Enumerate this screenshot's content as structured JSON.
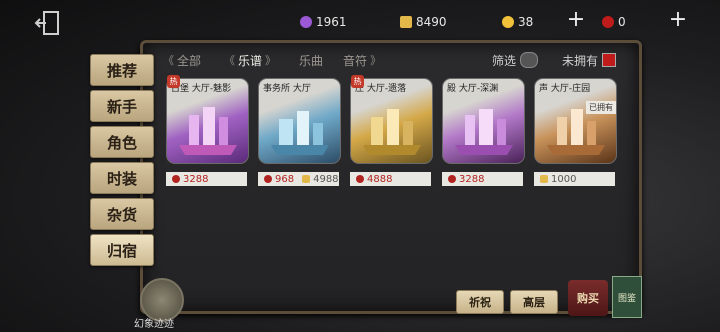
{
  "top_bar": {
    "purple_currency": "1961",
    "puzzle_currency": "8490",
    "gold_currency": "38",
    "red_currency": "0",
    "plus_symbol": "+"
  },
  "side_tabs": [
    "推荐",
    "新手",
    "角色",
    "时装",
    "杂货",
    "归宿"
  ],
  "active_side_tab": "归宿",
  "filter_tabs": [
    {
      "label": "全部",
      "selected": false
    },
    {
      "label": "乐谱",
      "selected": true
    },
    {
      "label": "乐曲",
      "selected": false
    },
    {
      "label": "音符",
      "selected": false
    }
  ],
  "screen_label": "筛选",
  "not_owned_label": "未拥有",
  "cards": [
    {
      "title": "古堡 大厅-魅影",
      "hot": true,
      "price": "3288",
      "hot_label": "热",
      "colors": [
        "#6a3a8c",
        "#d48ad8",
        "#f0d0f0"
      ]
    },
    {
      "title": "事务所 大厅",
      "hot": false,
      "price_red": "968",
      "price_gold": "4988",
      "colors": [
        "#2f5f7a",
        "#6fa8c8",
        "#d6eef8"
      ]
    },
    {
      "title": "庄 大厅-遗落",
      "hot": true,
      "price": "4888",
      "hot_label": "热",
      "colors": [
        "#6a5420",
        "#c9a040",
        "#f6e4a0"
      ]
    },
    {
      "title": "殿 大厅-深渊",
      "hot": false,
      "price": "3288",
      "colors": [
        "#5a2a6a",
        "#b278c8",
        "#eed0f4"
      ]
    },
    {
      "title": "声 大厅-庄园",
      "hot": false,
      "price_gold_only": "1000",
      "owned": "已拥有",
      "colors": [
        "#6a3a1a",
        "#c28a50",
        "#f6e2c4"
      ]
    }
  ],
  "bottom": {
    "avatar_label": "幻象迹迹",
    "btn1": "祈祝",
    "btn2": "高层",
    "shop": "购买",
    "book": "图鉴"
  },
  "colors": {
    "accent_red": "#b0231f",
    "panel_border": "#5b4d3a",
    "tab_bg": "#d9c8a3"
  }
}
